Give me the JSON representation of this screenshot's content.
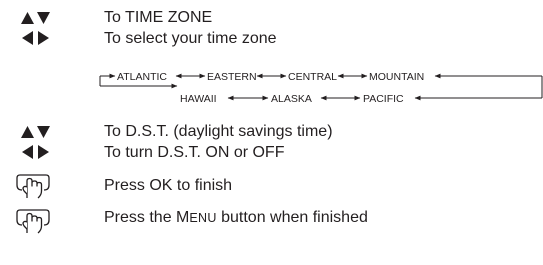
{
  "steps": {
    "time_zone_title": "To TIME ZONE",
    "time_zone_select": "To select your time zone",
    "dst_title": "To D.S.T. (daylight savings time)",
    "dst_toggle": "To turn D.S.T. ON or OFF",
    "press_ok": "Press OK to finish",
    "press_menu_prefix": "Press the ",
    "press_menu_first": "M",
    "press_menu_rest": "ENU",
    "press_menu_suffix": " button when finished"
  },
  "time_zones": {
    "row1": [
      "ATLANTIC",
      "EASTERN",
      "CENTRAL",
      "MOUNTAIN"
    ],
    "row2": [
      "HAWAII",
      "ALASKA",
      "PACIFIC"
    ]
  },
  "icons": {
    "up_down": "up-down-arrows-icon",
    "left_right": "left-right-arrows-icon",
    "press": "finger-press-button-icon"
  },
  "colors": {
    "ink": "#231f20",
    "background": "#ffffff"
  }
}
